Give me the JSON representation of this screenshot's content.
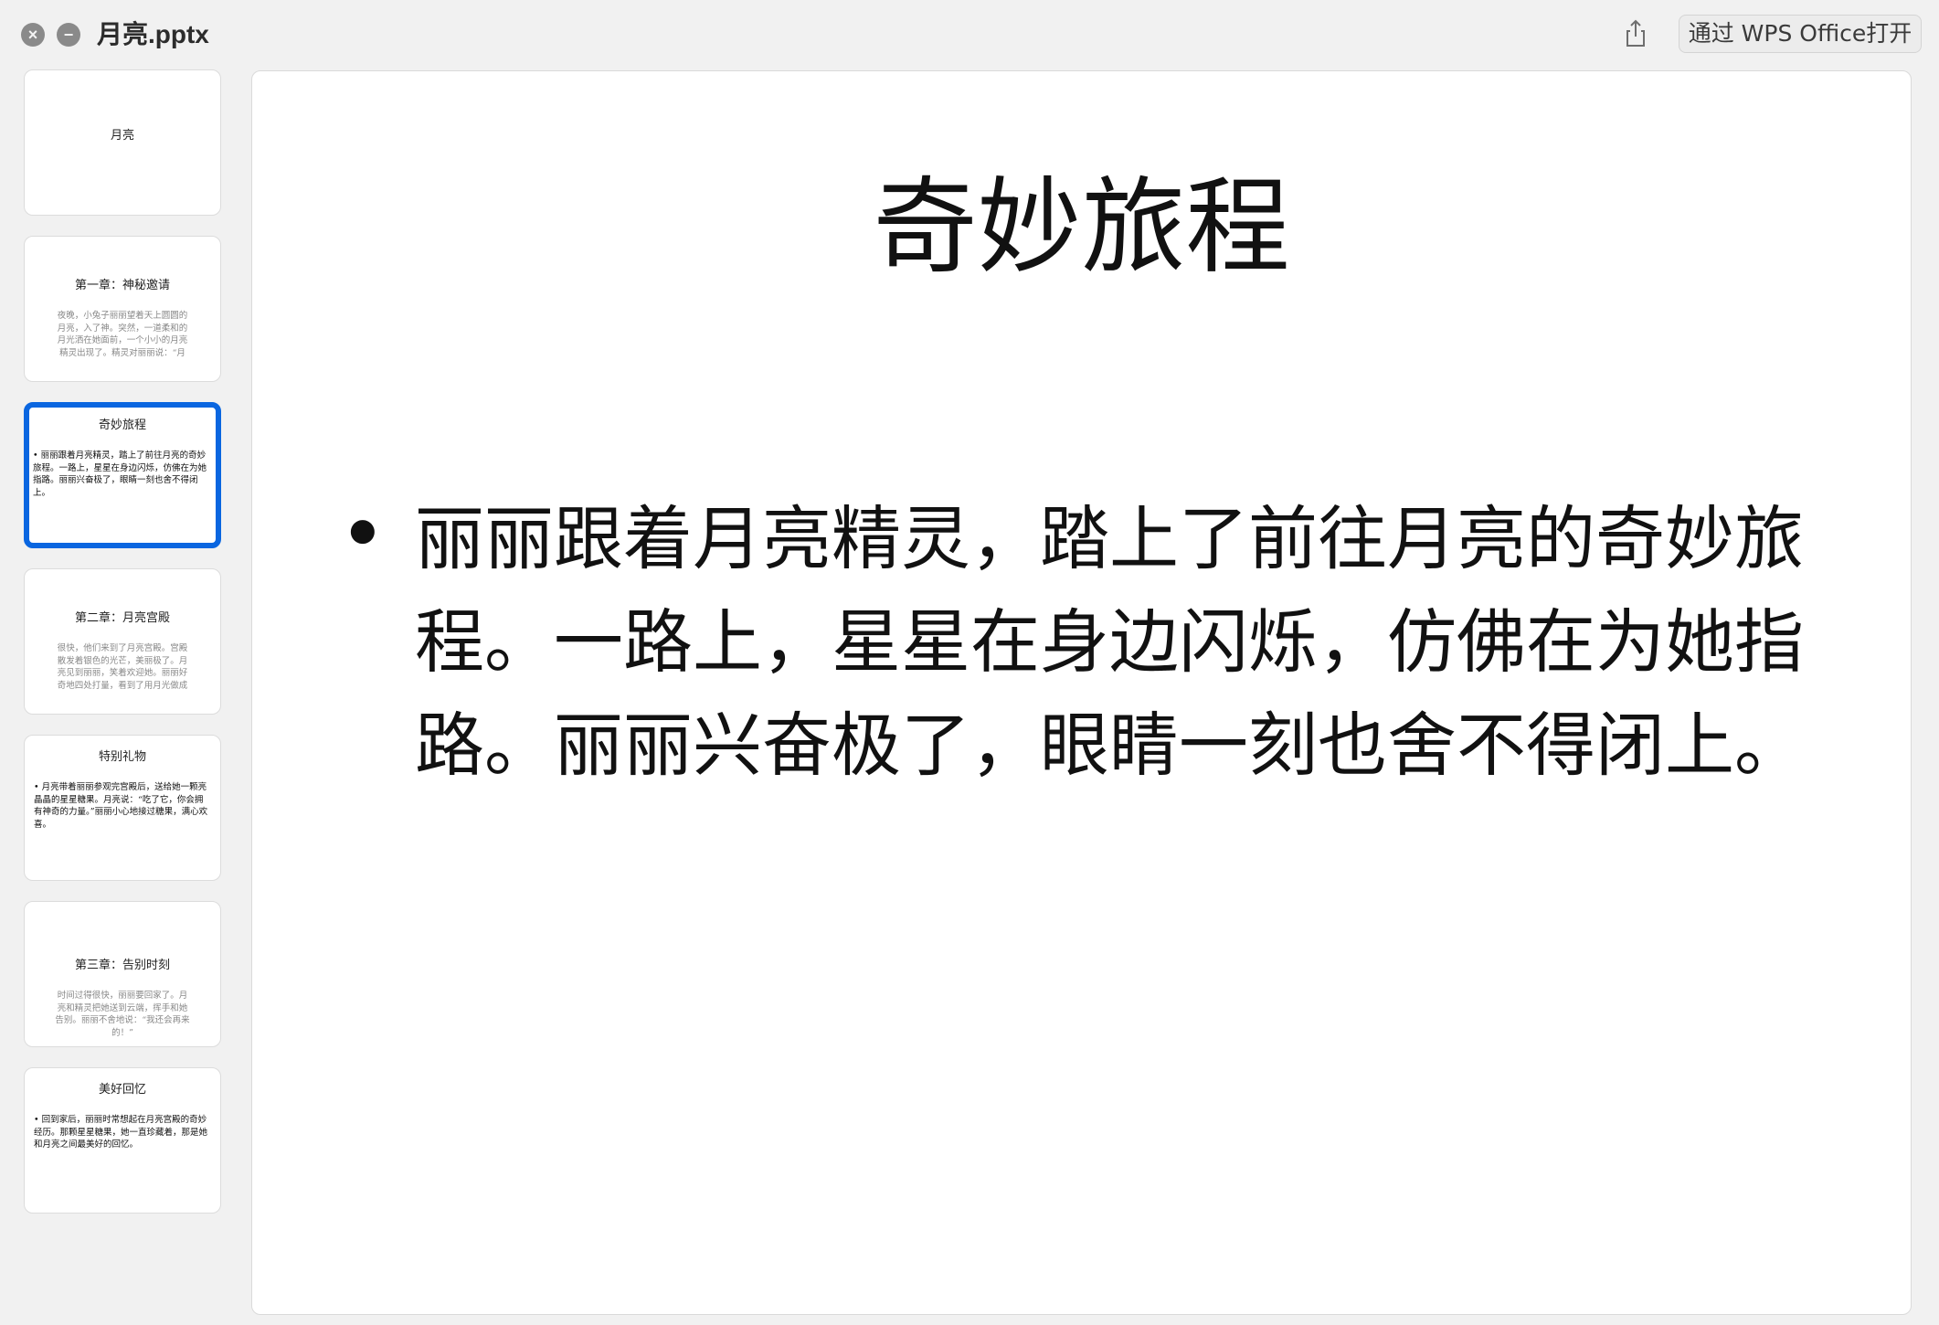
{
  "window": {
    "title": "月亮.pptx",
    "open_button_label": "通过 WPS Office打开"
  },
  "icons": {
    "close": "close-icon",
    "minimize": "minimize-icon",
    "share": "share-icon"
  },
  "slides": [
    {
      "title": "月亮",
      "body": "",
      "body_style": "none"
    },
    {
      "title": "第一章：神秘邀请",
      "body": "夜晚，小兔子丽丽望着天上圆圆的月亮，入了神。突然，一道柔和的月光洒在她面前，一个小小的月亮精灵出现了。精灵对丽丽说：“月",
      "body_style": "faded"
    },
    {
      "title": "奇妙旅程",
      "body": "丽丽跟着月亮精灵，踏上了前往月亮的奇妙旅程。一路上，星星在身边闪烁，仿佛在为她指路。丽丽兴奋极了，眼睛一刻也舍不得闭上。",
      "body_style": "bullet"
    },
    {
      "title": "第二章：月亮宫殿",
      "body": "很快，他们来到了月亮宫殿。宫殿散发着银色的光芒，美丽极了。月亮见到丽丽，笑着欢迎她。丽丽好奇地四处打量，看到了用月光做成",
      "body_style": "faded"
    },
    {
      "title": "特别礼物",
      "body": "月亮带着丽丽参观完宫殿后，送给她一颗亮晶晶的星星糖果。月亮说：“吃了它，你会拥有神奇的力量。”丽丽小心地接过糖果，满心欢喜。",
      "body_style": "bullet"
    },
    {
      "title": "第三章：告别时刻",
      "body": "时间过得很快，丽丽要回家了。月亮和精灵把她送到云端，挥手和她告别。丽丽不舍地说：“我还会再来的！”",
      "body_style": "faded"
    },
    {
      "title": "美好回忆",
      "body": "回到家后，丽丽时常想起在月亮宫殿的奇妙经历。那颗星星糖果，她一直珍藏着，那是她和月亮之间最美好的回忆。",
      "body_style": "bullet"
    }
  ],
  "selected_slide": 2,
  "current_slide": {
    "title": "奇妙旅程",
    "bullet": "丽丽跟着月亮精灵，踏上了前往月亮的奇妙旅程。一路上，星星在身边闪烁，仿佛在为她指路。丽丽兴奋极了，眼睛一刻也舍不得闭上。"
  },
  "colors": {
    "accent": "#0a66e0",
    "background": "#f1f1f1"
  }
}
